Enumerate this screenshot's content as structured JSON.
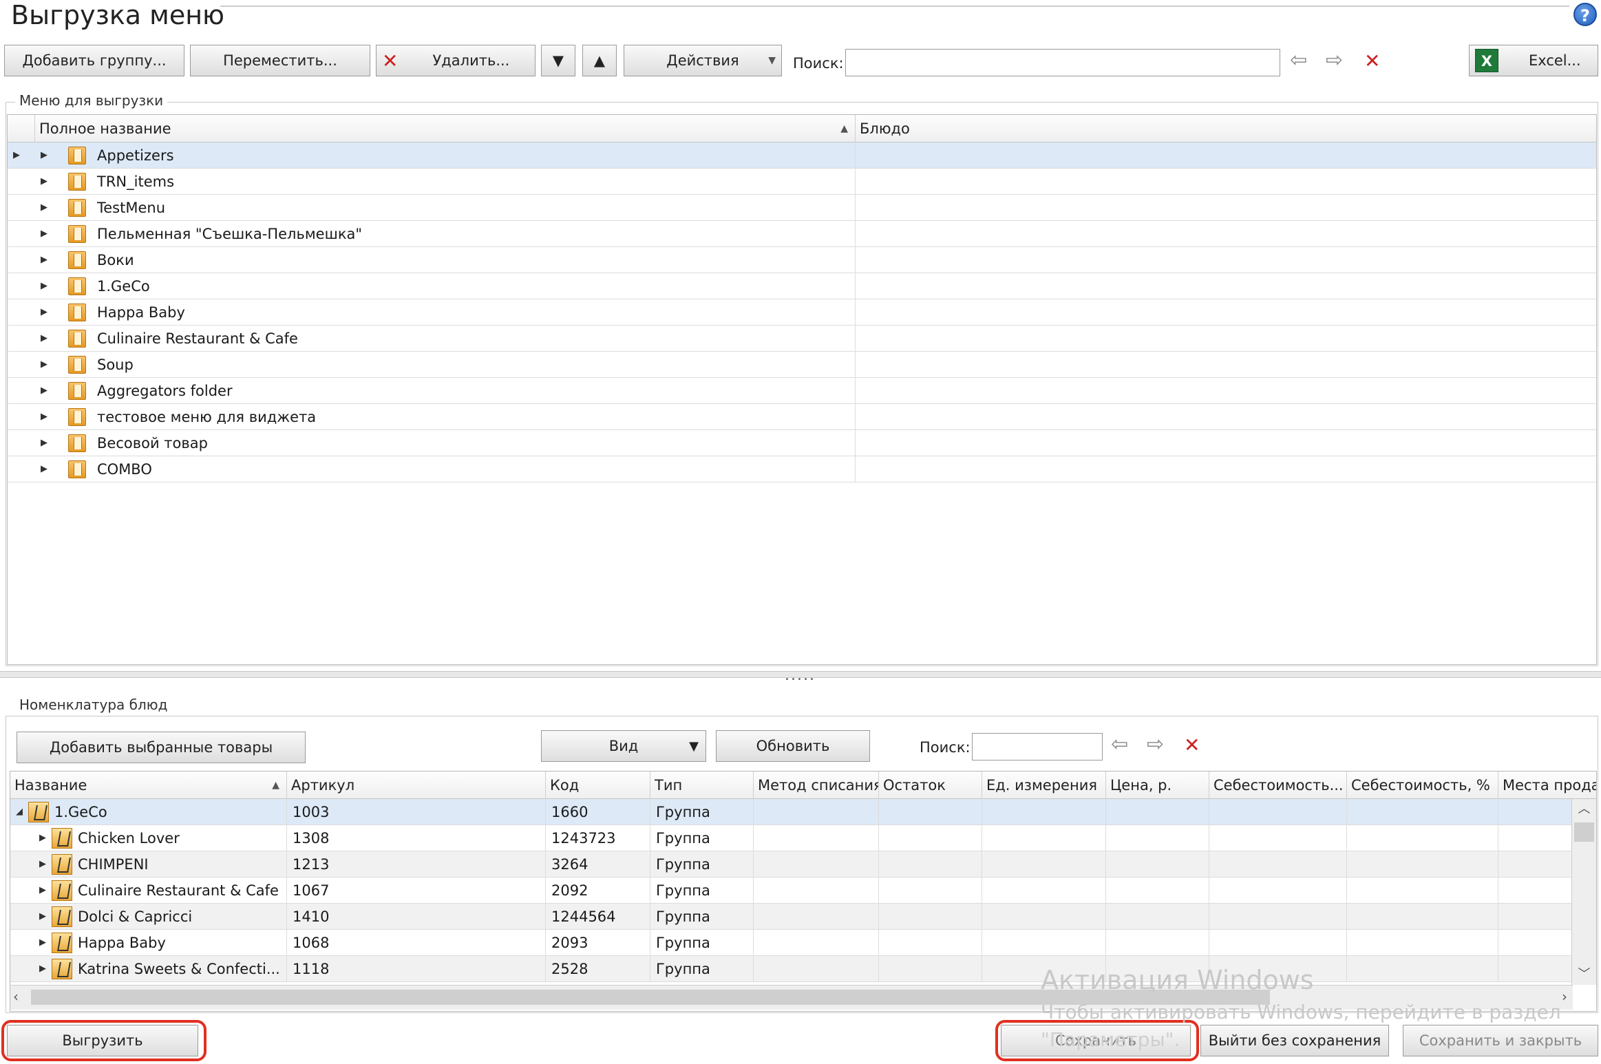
{
  "window": {
    "title": "Выгрузка меню",
    "help": "?"
  },
  "toolbar": {
    "add_group": "Добавить группу...",
    "move": "Переместить...",
    "delete": "Удалить...",
    "actions": "Действия",
    "search_label": "Поиск:",
    "excel": "Excel..."
  },
  "menu_panel": {
    "legend": "Меню для выгрузки",
    "columns": [
      "Полное название",
      "Блюдо"
    ],
    "rows": [
      {
        "name": "Appetizers",
        "selected": true
      },
      {
        "name": "TRN_items"
      },
      {
        "name": "TestMenu"
      },
      {
        "name": "Пельменная \"Съешка-Пельмешка\""
      },
      {
        "name": "Воки"
      },
      {
        "name": "1.GeCo"
      },
      {
        "name": "Happa Baby"
      },
      {
        "name": "Culinaire Restaurant & Cafe"
      },
      {
        "name": "Soup"
      },
      {
        "name": "Aggregators folder"
      },
      {
        "name": "тестовое меню для виджета"
      },
      {
        "name": "Весовой товар"
      },
      {
        "name": "COMBO"
      }
    ]
  },
  "splitter_dots": ".....",
  "nomenclature": {
    "legend": "Номенклатура блюд",
    "add_selected": "Добавить выбранные товары",
    "view": "Вид",
    "refresh": "Обновить",
    "search_label": "Поиск:",
    "columns": [
      "Название",
      "Артикул",
      "Код",
      "Тип",
      "Метод списания",
      "Остаток",
      "Ед. измерения",
      "Цена, р.",
      "Себестоимость...",
      "Себестоимость, %",
      "Места продаж"
    ],
    "rows": [
      {
        "name": "1.GeCo",
        "article": "1003",
        "code": "1660",
        "type": "Группа"
      },
      {
        "name": "Chicken Lover",
        "article": "1308",
        "code": "1243723",
        "type": "Группа"
      },
      {
        "name": "CHIMPENI",
        "article": "1213",
        "code": "3264",
        "type": "Группа"
      },
      {
        "name": "Culinaire Restaurant & Cafe",
        "article": "1067",
        "code": "2092",
        "type": "Группа"
      },
      {
        "name": "Dolci & Capricci",
        "article": "1410",
        "code": "1244564",
        "type": "Группа"
      },
      {
        "name": "Happa Baby",
        "article": "1068",
        "code": "2093",
        "type": "Группа"
      },
      {
        "name": "Katrina Sweets & Confecti...",
        "article": "1118",
        "code": "2528",
        "type": "Группа"
      }
    ]
  },
  "footer": {
    "export": "Выгрузить",
    "save": "Сохранить",
    "exit_no_save": "Выйти без сохранения",
    "save_close": "Сохранить и закрыть"
  },
  "watermark": {
    "line1": "Активация Windows",
    "line2": "Чтобы активировать Windows, перейдите в раздел",
    "line3": "\"Параметры\"."
  },
  "colors": {
    "highlight": "#e03020",
    "selected_row": "#dde9f6",
    "delete_x": "#cc2020"
  }
}
